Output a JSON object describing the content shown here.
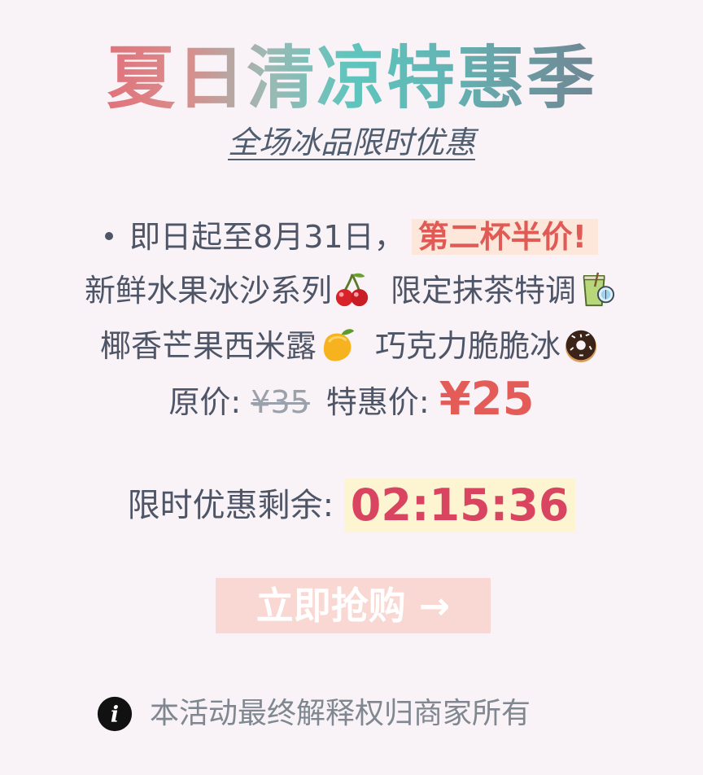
{
  "header": {
    "title": "夏日清凉特惠季",
    "subtitle": "全场冰品限时优惠"
  },
  "promo": {
    "period_text": "即日起至8月31日，",
    "highlight": "第二杯半价!",
    "products": [
      {
        "name": "新鲜水果冰沙系列",
        "icon": "cherry-icon"
      },
      {
        "name": "限定抹茶特调",
        "icon": "matcha-drink-icon"
      },
      {
        "name": "椰香芒果西米露",
        "icon": "mango-icon"
      },
      {
        "name": "巧克力脆脆冰",
        "icon": "donut-icon"
      }
    ]
  },
  "price": {
    "original_label": "原价:",
    "original_value": "¥35",
    "special_label": "特惠价:",
    "special_value": "¥25"
  },
  "countdown": {
    "label": "限时优惠剩余:",
    "value": "02:15:36"
  },
  "cta": {
    "label": "立即抢购 →"
  },
  "footer": {
    "icon": "info-icon",
    "text": "本活动最终解释权归商家所有"
  },
  "colors": {
    "background": "#f9f3f8",
    "accent_red": "#e45c57",
    "countdown_red": "#d94560",
    "highlight_orange_bg": "#fde7da",
    "countdown_bg": "#fdf5d2",
    "button_bg": "#f9d7d2",
    "body_text": "#4d5566",
    "muted_text": "#7f8790"
  }
}
